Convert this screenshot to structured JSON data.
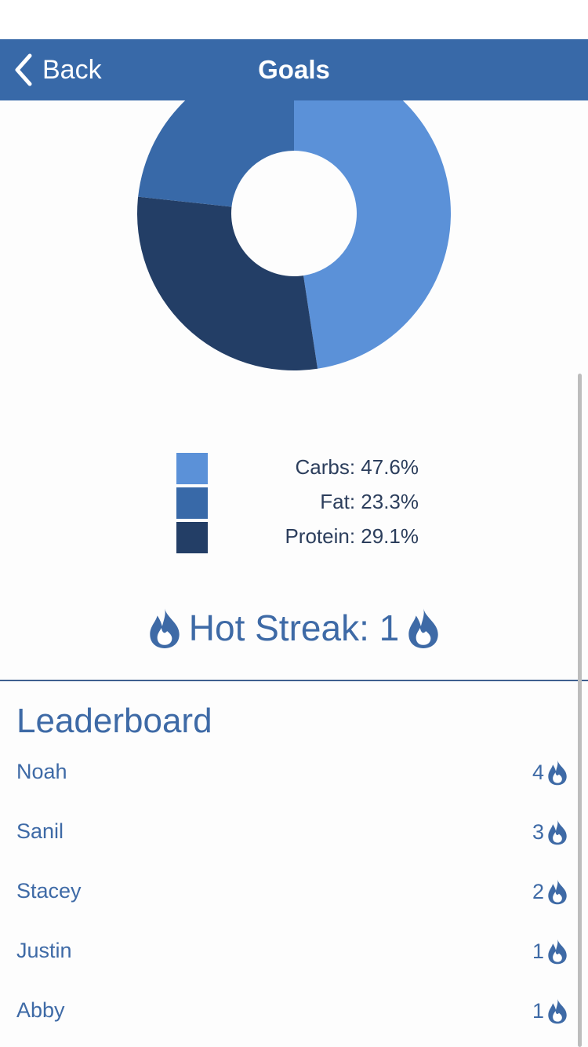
{
  "navbar": {
    "back_label": "Back",
    "title": "Goals"
  },
  "colors": {
    "navbar": "#3869a8",
    "carbs": "#5b91d8",
    "fat": "#3869a8",
    "protein": "#233e66",
    "accent_text": "#3e6aa6"
  },
  "chart_data": {
    "type": "pie",
    "categories": [
      "Carbs",
      "Fat",
      "Protein"
    ],
    "values": [
      47.6,
      23.3,
      29.1
    ],
    "colors": [
      "#5b91d8",
      "#3869a8",
      "#233e66"
    ]
  },
  "legend": {
    "items": [
      {
        "label": "Carbs: 47.6%"
      },
      {
        "label": "Fat: 23.3%"
      },
      {
        "label": "Protein: 29.1%"
      }
    ]
  },
  "streak": {
    "text": "Hot Streak: 1",
    "icon": "flame-icon"
  },
  "leaderboard": {
    "title": "Leaderboard",
    "entries": [
      {
        "name": "Noah",
        "score": "4"
      },
      {
        "name": "Sanil",
        "score": "3"
      },
      {
        "name": "Stacey",
        "score": "2"
      },
      {
        "name": "Justin",
        "score": "1"
      },
      {
        "name": "Abby",
        "score": "1"
      }
    ]
  }
}
